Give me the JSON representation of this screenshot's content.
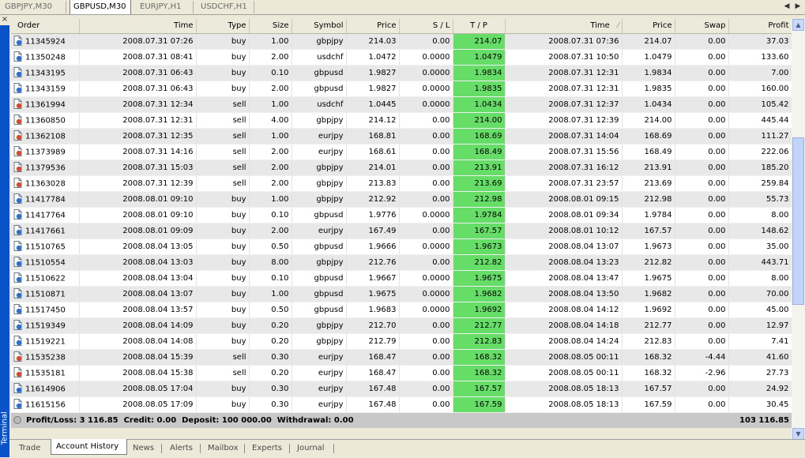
{
  "chart_tabs": [
    "GBPJPY,M30",
    "GBPUSD,M30",
    "EURJPY,H1",
    "USDCHF,H1"
  ],
  "active_chart_tab": 1,
  "columns": [
    "Order",
    "Time",
    "Type",
    "Size",
    "Symbol",
    "Price",
    "S / L",
    "T / P",
    "Time",
    "Price",
    "Swap",
    "Profit"
  ],
  "rows": [
    [
      "11345924",
      "2008.07.31 07:26",
      "buy",
      "1.00",
      "gbpjpy",
      "214.03",
      "0.00",
      "214.07",
      "2008.07.31 07:36",
      "214.07",
      "0.00",
      "37.03"
    ],
    [
      "11350248",
      "2008.07.31 08:41",
      "buy",
      "2.00",
      "usdchf",
      "1.0472",
      "0.0000",
      "1.0479",
      "2008.07.31 10:50",
      "1.0479",
      "0.00",
      "133.60"
    ],
    [
      "11343195",
      "2008.07.31 06:43",
      "buy",
      "0.10",
      "gbpusd",
      "1.9827",
      "0.0000",
      "1.9834",
      "2008.07.31 12:31",
      "1.9834",
      "0.00",
      "7.00"
    ],
    [
      "11343159",
      "2008.07.31 06:43",
      "buy",
      "2.00",
      "gbpusd",
      "1.9827",
      "0.0000",
      "1.9835",
      "2008.07.31 12:31",
      "1.9835",
      "0.00",
      "160.00"
    ],
    [
      "11361994",
      "2008.07.31 12:34",
      "sell",
      "1.00",
      "usdchf",
      "1.0445",
      "0.0000",
      "1.0434",
      "2008.07.31 12:37",
      "1.0434",
      "0.00",
      "105.42"
    ],
    [
      "11360850",
      "2008.07.31 12:31",
      "sell",
      "4.00",
      "gbpjpy",
      "214.12",
      "0.00",
      "214.00",
      "2008.07.31 12:39",
      "214.00",
      "0.00",
      "445.44"
    ],
    [
      "11362108",
      "2008.07.31 12:35",
      "sell",
      "1.00",
      "eurjpy",
      "168.81",
      "0.00",
      "168.69",
      "2008.07.31 14:04",
      "168.69",
      "0.00",
      "111.27"
    ],
    [
      "11373989",
      "2008.07.31 14:16",
      "sell",
      "2.00",
      "eurjpy",
      "168.61",
      "0.00",
      "168.49",
      "2008.07.31 15:56",
      "168.49",
      "0.00",
      "222.06"
    ],
    [
      "11379536",
      "2008.07.31 15:03",
      "sell",
      "2.00",
      "gbpjpy",
      "214.01",
      "0.00",
      "213.91",
      "2008.07.31 16:12",
      "213.91",
      "0.00",
      "185.20"
    ],
    [
      "11363028",
      "2008.07.31 12:39",
      "sell",
      "2.00",
      "gbpjpy",
      "213.83",
      "0.00",
      "213.69",
      "2008.07.31 23:57",
      "213.69",
      "0.00",
      "259.84"
    ],
    [
      "11417784",
      "2008.08.01 09:10",
      "buy",
      "1.00",
      "gbpjpy",
      "212.92",
      "0.00",
      "212.98",
      "2008.08.01 09:15",
      "212.98",
      "0.00",
      "55.73"
    ],
    [
      "11417764",
      "2008.08.01 09:10",
      "buy",
      "0.10",
      "gbpusd",
      "1.9776",
      "0.0000",
      "1.9784",
      "2008.08.01 09:34",
      "1.9784",
      "0.00",
      "8.00"
    ],
    [
      "11417661",
      "2008.08.01 09:09",
      "buy",
      "2.00",
      "eurjpy",
      "167.49",
      "0.00",
      "167.57",
      "2008.08.01 10:12",
      "167.57",
      "0.00",
      "148.62"
    ],
    [
      "11510765",
      "2008.08.04 13:05",
      "buy",
      "0.50",
      "gbpusd",
      "1.9666",
      "0.0000",
      "1.9673",
      "2008.08.04 13:07",
      "1.9673",
      "0.00",
      "35.00"
    ],
    [
      "11510554",
      "2008.08.04 13:03",
      "buy",
      "8.00",
      "gbpjpy",
      "212.76",
      "0.00",
      "212.82",
      "2008.08.04 13:23",
      "212.82",
      "0.00",
      "443.71"
    ],
    [
      "11510622",
      "2008.08.04 13:04",
      "buy",
      "0.10",
      "gbpusd",
      "1.9667",
      "0.0000",
      "1.9675",
      "2008.08.04 13:47",
      "1.9675",
      "0.00",
      "8.00"
    ],
    [
      "11510871",
      "2008.08.04 13:07",
      "buy",
      "1.00",
      "gbpusd",
      "1.9675",
      "0.0000",
      "1.9682",
      "2008.08.04 13:50",
      "1.9682",
      "0.00",
      "70.00"
    ],
    [
      "11517450",
      "2008.08.04 13:57",
      "buy",
      "0.50",
      "gbpusd",
      "1.9683",
      "0.0000",
      "1.9692",
      "2008.08.04 14:12",
      "1.9692",
      "0.00",
      "45.00"
    ],
    [
      "11519349",
      "2008.08.04 14:09",
      "buy",
      "0.20",
      "gbpjpy",
      "212.70",
      "0.00",
      "212.77",
      "2008.08.04 14:18",
      "212.77",
      "0.00",
      "12.97"
    ],
    [
      "11519221",
      "2008.08.04 14:08",
      "buy",
      "0.20",
      "gbpjpy",
      "212.79",
      "0.00",
      "212.83",
      "2008.08.04 14:24",
      "212.83",
      "0.00",
      "7.41"
    ],
    [
      "11535238",
      "2008.08.04 15:39",
      "sell",
      "0.30",
      "eurjpy",
      "168.47",
      "0.00",
      "168.32",
      "2008.08.05 00:11",
      "168.32",
      "-4.44",
      "41.60"
    ],
    [
      "11535181",
      "2008.08.04 15:38",
      "sell",
      "0.20",
      "eurjpy",
      "168.47",
      "0.00",
      "168.32",
      "2008.08.05 00:11",
      "168.32",
      "-2.96",
      "27.73"
    ],
    [
      "11614906",
      "2008.08.05 17:04",
      "buy",
      "0.30",
      "eurjpy",
      "167.48",
      "0.00",
      "167.57",
      "2008.08.05 18:13",
      "167.57",
      "0.00",
      "24.92"
    ],
    [
      "11615156",
      "2008.08.05 17:09",
      "buy",
      "0.30",
      "eurjpy",
      "167.48",
      "0.00",
      "167.59",
      "2008.08.05 18:13",
      "167.59",
      "0.00",
      "30.45"
    ]
  ],
  "summary": {
    "text": "Profit/Loss: 3 116.85  Credit: 0.00  Deposit: 100 000.00  Withdrawal: 0.00",
    "total": "103 116.85"
  },
  "bottom_tabs": [
    "Trade",
    "Account History",
    "News",
    "Alerts",
    "Mailbox",
    "Experts",
    "Journal"
  ],
  "active_bottom_tab": 1,
  "terminal_label": "Terminal",
  "colors": {
    "tp_highlight": "#66dd66",
    "buy_icon": "#2a6fd6",
    "sell_icon": "#d84a2a",
    "sidebar": "#0a52c7"
  }
}
